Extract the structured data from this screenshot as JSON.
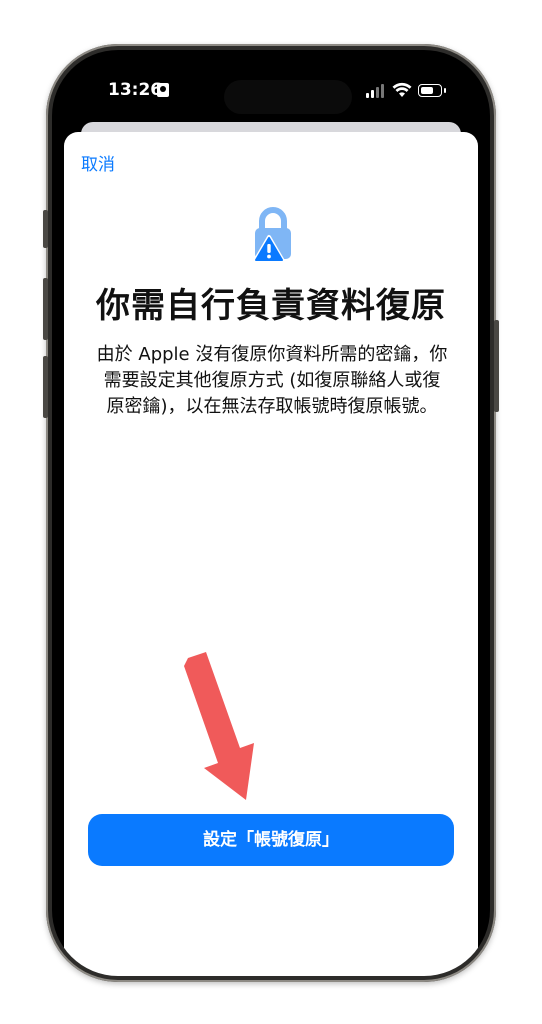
{
  "status_bar": {
    "time": "13:26"
  },
  "sheet": {
    "cancel_label": "取消",
    "title": "你需自行負責資料復原",
    "body_lines": [
      "由於 Apple 沒有復原你資料所需的密鑰，你",
      "需要設定其他復原方式 (如復原聯絡人或復",
      "原密鑰)，以在無法存取帳號時復原帳號。"
    ],
    "primary_button_label": "設定「帳號復原」"
  },
  "colors": {
    "accent": "#0a7aff",
    "lock_light": "#7fb6f5",
    "warning_triangle": "#0a7aff",
    "annotation_arrow": "#f05a5a"
  },
  "icons": {
    "lock": "lock-with-warning-icon",
    "wifi": "wifi-icon",
    "battery": "battery-icon",
    "signal": "cellular-signal-icon",
    "id": "id-card-icon"
  }
}
